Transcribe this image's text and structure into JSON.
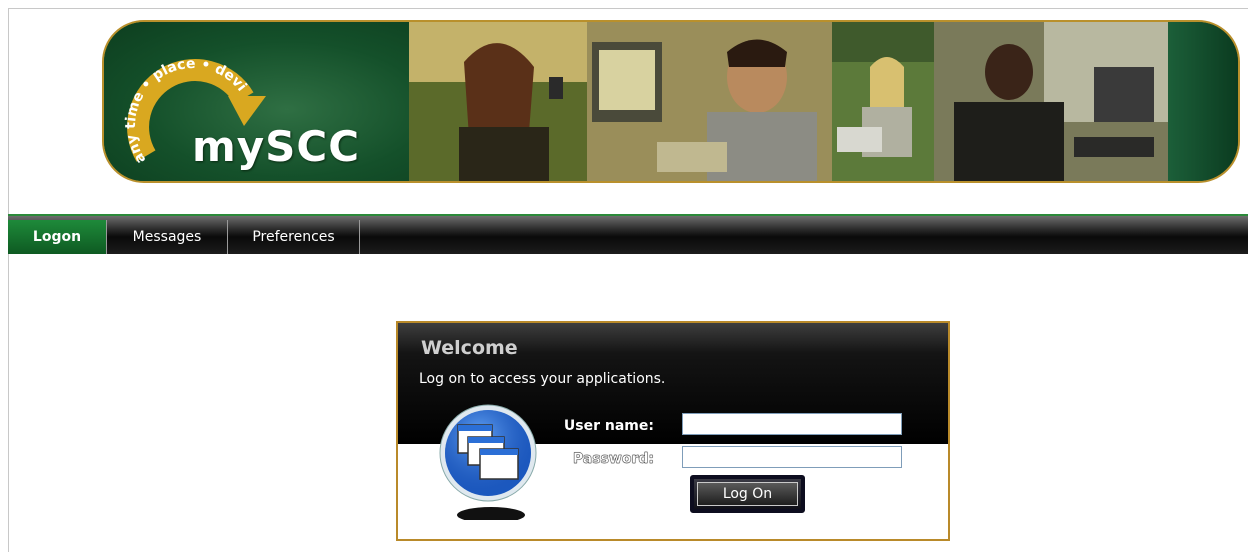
{
  "banner": {
    "logo_text": "mySCC",
    "logo_tagline": "any time • place • device"
  },
  "nav": {
    "tabs": [
      {
        "label": "Logon",
        "active": true
      },
      {
        "label": "Messages",
        "active": false
      },
      {
        "label": "Preferences",
        "active": false
      }
    ]
  },
  "login": {
    "title": "Welcome",
    "subtitle": "Log on to access your applications.",
    "username_label": "User name:",
    "password_label": "Password:",
    "username_value": "",
    "password_value": "",
    "button_label": "Log On"
  },
  "colors": {
    "brand_green": "#1e8a3a",
    "accent_gold": "#b9902c",
    "header_black": "#000000"
  }
}
